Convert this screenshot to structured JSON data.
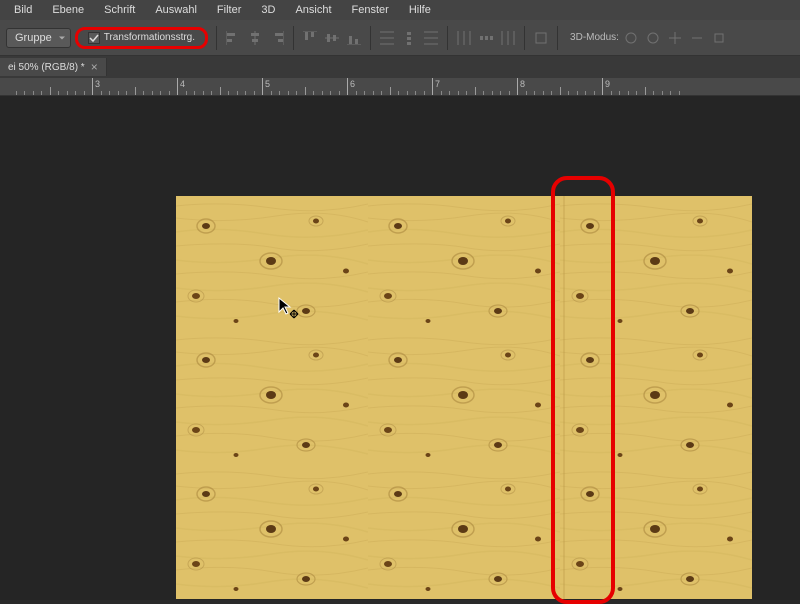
{
  "menu": {
    "items": [
      "Bild",
      "Ebene",
      "Schrift",
      "Auswahl",
      "Filter",
      "3D",
      "Ansicht",
      "Fenster",
      "Hilfe"
    ]
  },
  "options": {
    "group_dropdown": "Gruppe",
    "transform_controls_label": "Transformationsstrg.",
    "transform_controls_checked": true,
    "mode_3d_label": "3D-Modus:"
  },
  "tab": {
    "title": "ei 50% (RGB/8) *"
  },
  "ruler": {
    "labels": [
      "3",
      "4",
      "5",
      "6",
      "7",
      "8",
      "9"
    ]
  },
  "highlights": {
    "option_box_color": "#e60000",
    "seam_box_color": "#e60000"
  }
}
